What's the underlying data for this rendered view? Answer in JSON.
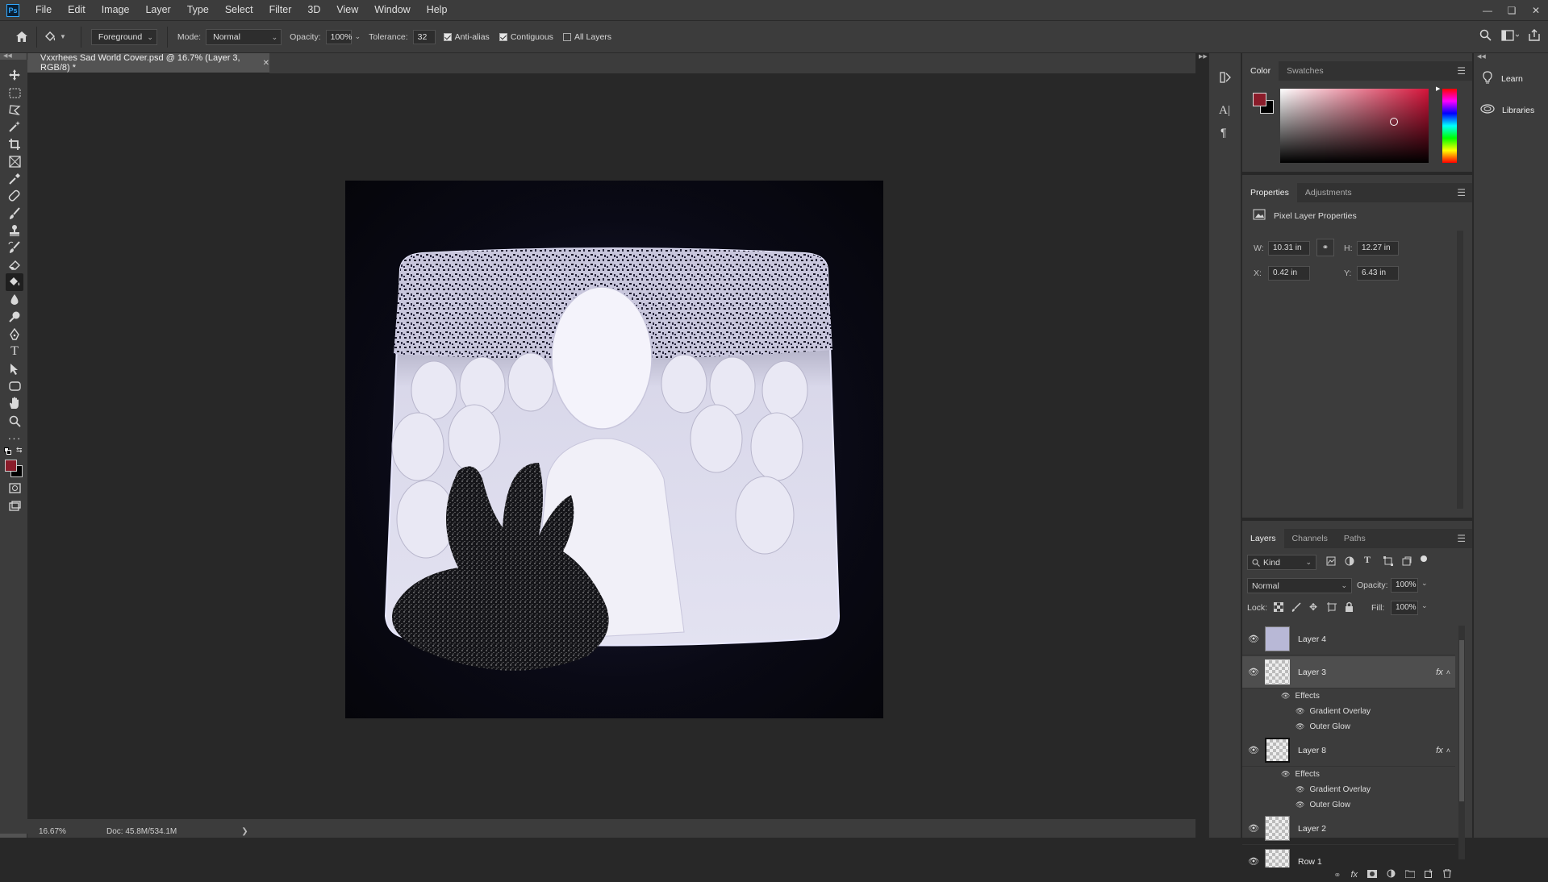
{
  "menubar": {
    "logo": "Ps",
    "items": [
      "File",
      "Edit",
      "Image",
      "Layer",
      "Type",
      "Select",
      "Filter",
      "3D",
      "View",
      "Window",
      "Help"
    ]
  },
  "options": {
    "fill_source": "Foreground",
    "mode_label": "Mode:",
    "mode_value": "Normal",
    "opacity_label": "Opacity:",
    "opacity_value": "100%",
    "tolerance_label": "Tolerance:",
    "tolerance_value": "32",
    "anti_alias_label": "Anti-alias",
    "anti_alias_checked": true,
    "contiguous_label": "Contiguous",
    "contiguous_checked": true,
    "all_layers_label": "All Layers",
    "all_layers_checked": false
  },
  "document": {
    "tab_title": "Vxxrhees Sad World Cover.psd @ 16.7% (Layer 3, RGB/8) *",
    "zoom": "16.67%",
    "doc_size": "Doc: 45.8M/534.1M"
  },
  "colors": {
    "foreground": "#8a1c2a",
    "background": "#000000",
    "accent": "#31a8ff"
  },
  "color_panel": {
    "tabs": [
      "Color",
      "Swatches"
    ],
    "active_tab": "Color"
  },
  "properties_panel": {
    "tabs": [
      "Properties",
      "Adjustments"
    ],
    "title": "Pixel Layer Properties",
    "w_label": "W:",
    "w_value": "10.31 in",
    "h_label": "H:",
    "h_value": "12.27 in",
    "x_label": "X:",
    "x_value": "0.42 in",
    "y_label": "Y:",
    "y_value": "6.43 in"
  },
  "layers_panel": {
    "tabs": [
      "Layers",
      "Channels",
      "Paths"
    ],
    "kind_label": "Kind",
    "blend_mode": "Normal",
    "opacity_label": "Opacity:",
    "opacity_value": "100%",
    "lock_label": "Lock:",
    "fill_label": "Fill:",
    "fill_value": "100%",
    "effects_label": "Effects",
    "gradient_overlay": "Gradient Overlay",
    "outer_glow": "Outer Glow",
    "layers": [
      {
        "name": "Layer 4"
      },
      {
        "name": "Layer 3",
        "fx": "fx"
      },
      {
        "name": "Layer 8",
        "fx": "fx"
      },
      {
        "name": "Layer 2"
      },
      {
        "name": "Row 1"
      }
    ]
  },
  "right_dock": {
    "learn": "Learn",
    "libraries": "Libraries"
  }
}
